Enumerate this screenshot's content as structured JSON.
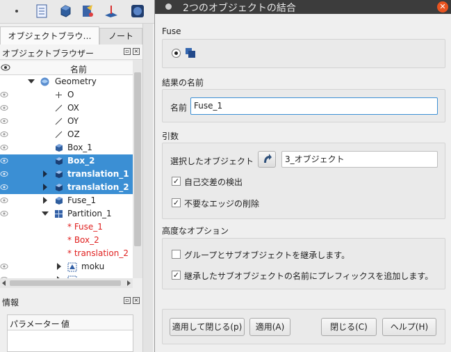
{
  "app": {
    "tabs": [
      {
        "label": "オブジェクトブラウ…"
      },
      {
        "label": "ノート"
      }
    ],
    "object_browser_title": "オブジェクトブラウザー",
    "column_name": "名前",
    "tree": [
      {
        "label": "Geometry",
        "icon": "geometry-icon"
      },
      {
        "label": "O",
        "icon": "point-icon"
      },
      {
        "label": "OX",
        "icon": "line-icon"
      },
      {
        "label": "OY",
        "icon": "line-icon"
      },
      {
        "label": "OZ",
        "icon": "line-icon"
      },
      {
        "label": "Box_1",
        "icon": "box-icon"
      },
      {
        "label": "Box_2",
        "icon": "box-icon"
      },
      {
        "label": "translation_1",
        "icon": "box-icon"
      },
      {
        "label": "translation_2",
        "icon": "box-icon"
      },
      {
        "label": "Fuse_1",
        "icon": "box-icon"
      },
      {
        "label": "Partition_1",
        "icon": "partition-icon"
      },
      {
        "label": "* Fuse_1"
      },
      {
        "label": "* Box_2"
      },
      {
        "label": "* translation_2"
      },
      {
        "label": "moku",
        "icon": "mesh-icon"
      }
    ],
    "info_title": "情報",
    "param_headers": [
      "パラメーター",
      "値"
    ]
  },
  "dialog": {
    "title": "2つのオブジェクトの結合",
    "fuse_label": "Fuse",
    "result_name_section": "結果の名前",
    "name_label": "名前",
    "name_value": "Fuse_1",
    "args_section": "引数",
    "selected_objects_label": "選択したオブジェクト",
    "selected_objects_value": "3_オブジェクト",
    "self_intersection_label": "自己交差の検出",
    "remove_edges_label": "不要なエッジの削除",
    "advanced_section": "高度なオプション",
    "inherit_groups_label": "グループとサブオブジェクトを継承します。",
    "prefix_label": "継承したサブオブジェクトの名前にプレフィックスを追加します。",
    "buttons": {
      "apply_close": "適用して閉じる(p)",
      "apply": "適用(A)",
      "close": "閉じる(C)",
      "help": "ヘルプ(H)"
    },
    "accent_color": "#3b8fd4",
    "close_color": "#e95420"
  }
}
